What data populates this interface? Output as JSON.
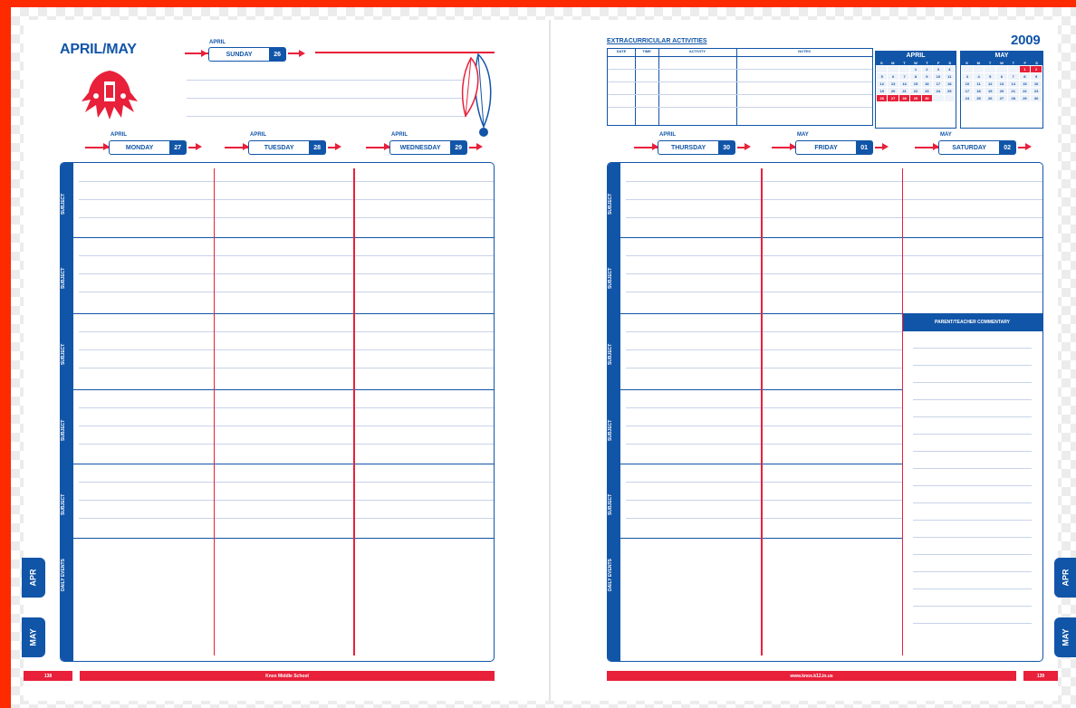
{
  "left_page": {
    "title": "APRIL/MAY",
    "sunday": {
      "month": "APRIL",
      "day": "SUNDAY",
      "date": "26"
    },
    "days": [
      {
        "month": "APRIL",
        "day": "MONDAY",
        "date": "27"
      },
      {
        "month": "APRIL",
        "day": "TUESDAY",
        "date": "28"
      },
      {
        "month": "APRIL",
        "day": "WEDNESDAY",
        "date": "29"
      }
    ],
    "row_labels": [
      "SUBJECT",
      "SUBJECT",
      "SUBJECT",
      "SUBJECT",
      "SUBJECT",
      "DAILY EVENTS"
    ],
    "footer_page": "138",
    "footer_text": "Knox Middle School",
    "tabs": [
      "APR",
      "MAY"
    ]
  },
  "right_page": {
    "year": "2009",
    "eca_title": "EXTRACURRICULAR ACTIVITIES",
    "eca_columns": [
      "DATE",
      "TIME",
      "ACTIVITY",
      "NOTES"
    ],
    "days": [
      {
        "month": "APRIL",
        "day": "THURSDAY",
        "date": "30"
      },
      {
        "month": "MAY",
        "day": "FRIDAY",
        "date": "01"
      },
      {
        "month": "MAY",
        "day": "SATURDAY",
        "date": "02"
      }
    ],
    "row_labels": [
      "SUBJECT",
      "SUBJECT",
      "SUBJECT",
      "SUBJECT",
      "SUBJECT",
      "DAILY EVENTS"
    ],
    "commentary_title": "PARENT/TEACHER COMMENTARY",
    "footer_text": "www.knox.k12.in.us",
    "footer_page": "139",
    "tabs": [
      "APR",
      "MAY"
    ]
  },
  "calendars": [
    {
      "month": "APRIL",
      "dow": [
        "S",
        "M",
        "T",
        "W",
        "T",
        "F",
        "S"
      ],
      "days": [
        "",
        "",
        "",
        "1",
        "2",
        "3",
        "4",
        "5",
        "6",
        "7",
        "8",
        "9",
        "10",
        "11",
        "12",
        "13",
        "14",
        "15",
        "16",
        "17",
        "18",
        "19",
        "20",
        "21",
        "22",
        "23",
        "24",
        "25",
        "26",
        "27",
        "28",
        "29",
        "30",
        "",
        ""
      ],
      "highlight": [
        "26",
        "27",
        "28",
        "29",
        "30"
      ]
    },
    {
      "month": "MAY",
      "dow": [
        "S",
        "M",
        "T",
        "W",
        "T",
        "F",
        "S"
      ],
      "days": [
        "",
        "",
        "",
        "",
        "",
        "1",
        "2",
        "3",
        "4",
        "5",
        "6",
        "7",
        "8",
        "9",
        "10",
        "11",
        "12",
        "13",
        "14",
        "15",
        "16",
        "17",
        "18",
        "19",
        "20",
        "21",
        "22",
        "23",
        "24",
        "25",
        "26",
        "27",
        "28",
        "29",
        "30"
      ],
      "highlight": [
        "1",
        "2"
      ]
    }
  ],
  "colors": {
    "blue": "#1155a8",
    "red": "#e8203a",
    "border": "#ff2a00"
  },
  "icons": {
    "logo": "native-chief-headdress-logo",
    "feathers": "feathers-icon"
  }
}
